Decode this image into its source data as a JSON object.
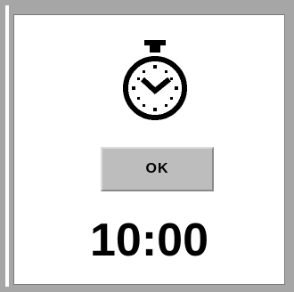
{
  "timer": {
    "icon": "stopwatch-icon",
    "button_label": "OK",
    "time": "10:00"
  },
  "colors": {
    "background": "#a6a6a6",
    "panel": "#ffffff",
    "button": "#bdbdbd"
  }
}
